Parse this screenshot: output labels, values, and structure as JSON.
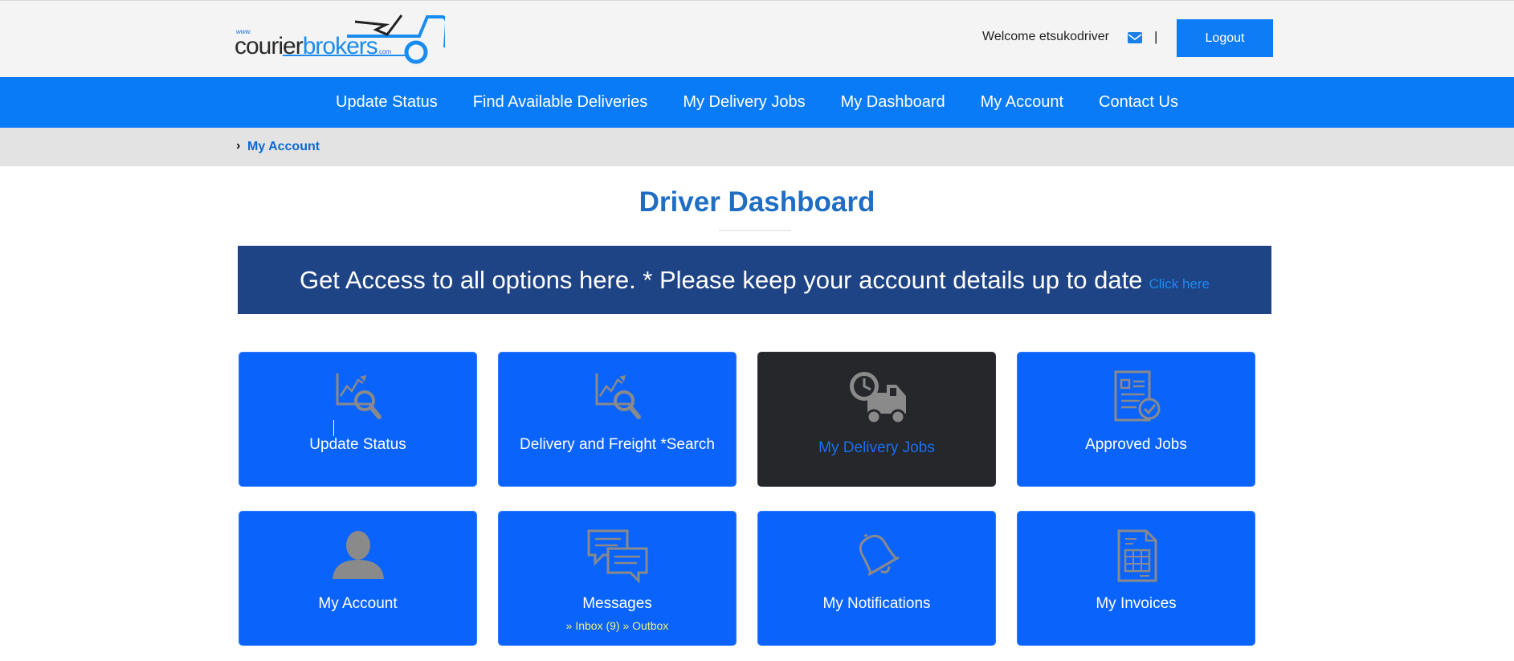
{
  "header": {
    "logo": {
      "www": "www.",
      "part1": "courier",
      "part2": "brokers",
      "dotcom": ".com"
    },
    "welcome": "Welcome etsukodriver",
    "separator": "|",
    "logout_label": "Logout",
    "mail_icon": "envelope-icon"
  },
  "nav": {
    "items": [
      {
        "label": "Update Status"
      },
      {
        "label": "Find Available Deliveries"
      },
      {
        "label": "My Delivery Jobs"
      },
      {
        "label": "My Dashboard"
      },
      {
        "label": "My Account"
      },
      {
        "label": "Contact Us"
      }
    ]
  },
  "breadcrumb": {
    "chevron": "›",
    "current": "My Account"
  },
  "page": {
    "title": "Driver Dashboard"
  },
  "banner": {
    "message": "Get Access to all options here. * Please keep your account details up to date",
    "link": "Click here"
  },
  "tiles": [
    {
      "label": "Update Status",
      "icon": "chart-search-icon"
    },
    {
      "label": "Delivery and Freight *Search",
      "icon": "chart-search-icon"
    },
    {
      "label": "My Delivery Jobs",
      "icon": "truck-clock-icon",
      "active": true
    },
    {
      "label": "Approved Jobs",
      "icon": "document-check-icon"
    },
    {
      "label": "My Account",
      "icon": "user-icon"
    },
    {
      "label": "Messages",
      "icon": "chat-bubbles-icon",
      "sub": "» Inbox (9) » Outbox"
    },
    {
      "label": "My Notifications",
      "icon": "bell-icon"
    },
    {
      "label": "My Invoices",
      "icon": "invoice-icon"
    }
  ],
  "colors": {
    "brand_blue": "#0a7bf6",
    "tile_blue": "#0a63fb",
    "banner_navy": "#1f4486",
    "title_blue": "#1f6ec4",
    "active_tile": "#25272b",
    "icon_gray": "#8a8a8a",
    "sub_yellow": "#f1f07a"
  }
}
